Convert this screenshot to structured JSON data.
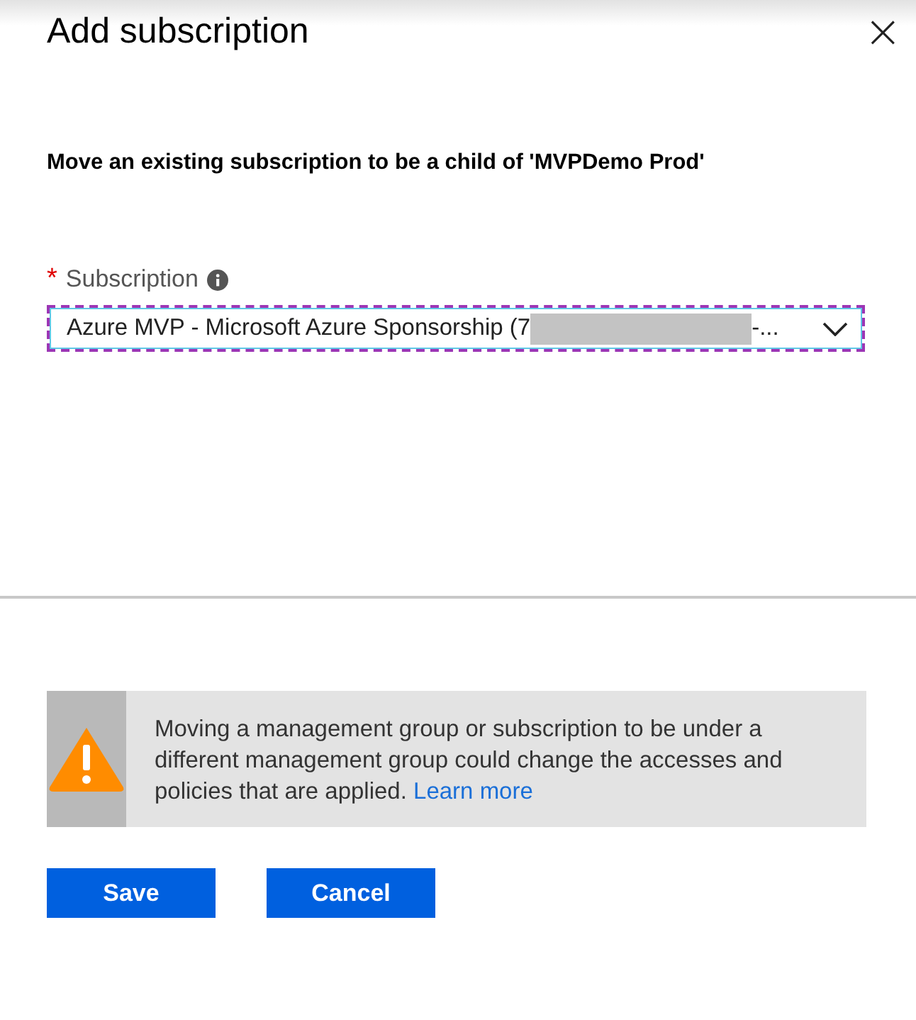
{
  "panel": {
    "title": "Add subscription",
    "close": "×"
  },
  "instruction": "Move an existing subscription to be a child of 'MVPDemo Prod'",
  "field": {
    "required_mark": "*",
    "label": "Subscription",
    "value": "Azure MVP - Microsoft Azure Sponsorship (7",
    "redacted": true,
    "value_tail": "-...",
    "focused": true
  },
  "warning": {
    "text": "Moving a management group or subscription to be under a different management group could change the accesses and policies that are applied.",
    "link": "Learn more"
  },
  "buttons": [
    {
      "label": "Save"
    },
    {
      "label": "Cancel"
    }
  ]
}
